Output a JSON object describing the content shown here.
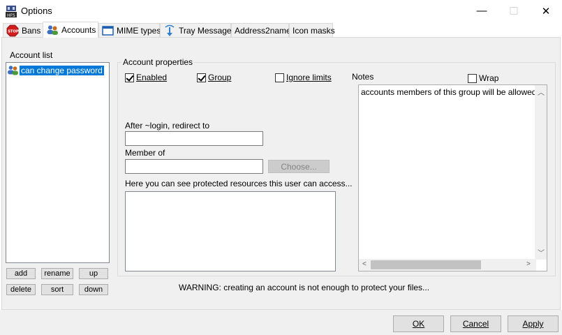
{
  "window": {
    "title": "Options",
    "icon": "hfs-app-icon",
    "controls": {
      "minimize": "—",
      "maximize": "☐",
      "close": "✕"
    }
  },
  "tabs": [
    {
      "label": "Bans",
      "icon": "stop-icon"
    },
    {
      "label": "Accounts",
      "icon": "users-icon",
      "active": true
    },
    {
      "label": "MIME types",
      "icon": "window-icon"
    },
    {
      "label": "Tray Message",
      "icon": "tray-icon"
    },
    {
      "label": "Address2name"
    },
    {
      "label": "Icon masks"
    }
  ],
  "account_list": {
    "label": "Account list",
    "items": [
      {
        "name": "can change password",
        "selected": true
      }
    ],
    "buttons": {
      "add": "add",
      "rename": "rename",
      "up": "up",
      "delete": "delete",
      "sort": "sort",
      "down": "down"
    }
  },
  "account_properties": {
    "label": "Account properties",
    "enabled": {
      "label": "Enabled",
      "checked": true
    },
    "group": {
      "label": "Group",
      "checked": true
    },
    "ignore_limits": {
      "label": "Ignore limits",
      "checked": false
    },
    "redirect_label": "After ~login, redirect to",
    "redirect_value": "",
    "member_of_label": "Member of",
    "member_of_value": "",
    "choose_button": "Choose...",
    "resources_label": "Here you can see protected resources this user can access..."
  },
  "notes": {
    "label": "Notes",
    "wrap": {
      "label": "Wrap",
      "checked": false
    },
    "text": "accounts members of this group will be allowed to ch"
  },
  "warning": "WARNING: creating an account is not enough to protect  your files...",
  "dialog_buttons": {
    "ok": "OK",
    "cancel": "Cancel",
    "apply": "Apply"
  },
  "colors": {
    "selection": "#0078d7",
    "panel": "#f0f0f0",
    "stop_red": "#d11d1d"
  }
}
